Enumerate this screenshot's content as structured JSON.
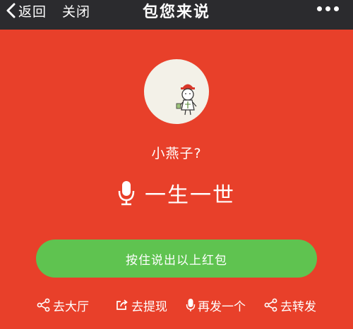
{
  "nav": {
    "back_label": "返回",
    "close_label": "关闭",
    "title": "包您来说",
    "more_icon": "more-dots-icon"
  },
  "sender": {
    "name": "小燕子?"
  },
  "voice": {
    "icon": "microphone-icon",
    "phrase": "一生一世"
  },
  "hold_button": {
    "label": "按住说出以上红包"
  },
  "actions": [
    {
      "icon": "share-icon",
      "label": "去大厅"
    },
    {
      "icon": "export-icon",
      "label": "去提现"
    },
    {
      "icon": "microphone-icon",
      "label": "再发一个"
    },
    {
      "icon": "share-icon",
      "label": "去转发"
    }
  ],
  "colors": {
    "background": "#e8402a",
    "navbar": "#2b2b2e",
    "button": "#5fc350",
    "avatar_bg": "#f3f1e8"
  }
}
